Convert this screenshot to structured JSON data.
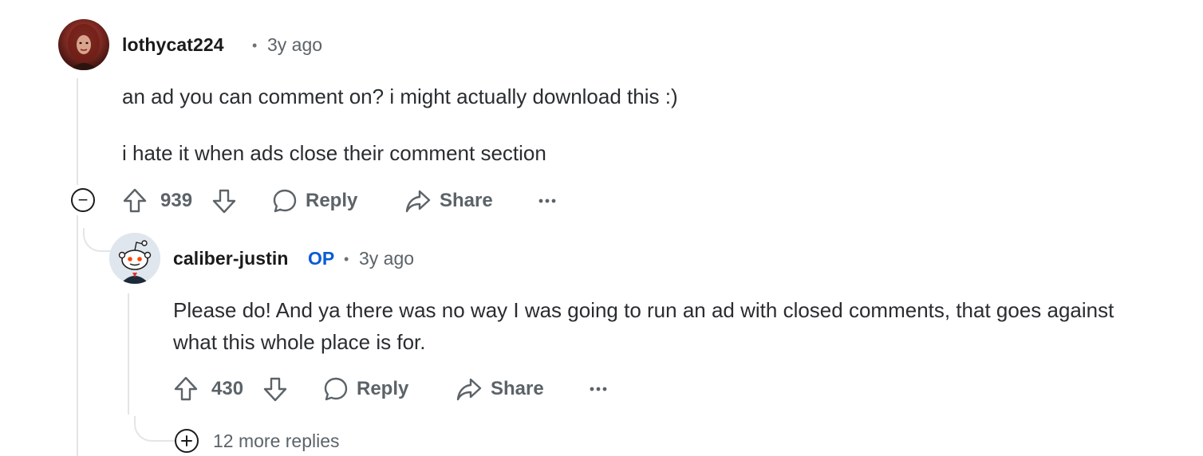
{
  "comment": {
    "username": "lothycat224",
    "separator": "•",
    "time": "3y ago",
    "paragraphs": [
      "an ad you can comment on? i might actually download this :)",
      "i hate it when ads close their comment section"
    ],
    "votes": "939",
    "reply_label": "Reply",
    "share_label": "Share",
    "collapse_symbol": "−"
  },
  "reply": {
    "username": "caliber-justin",
    "op_badge": "OP",
    "separator": "•",
    "time": "3y ago",
    "text": "Please do! And ya there was no way I was going to run an ad with closed comments, that goes against what this whole place is for.",
    "votes": "430",
    "reply_label": "Reply",
    "share_label": "Share"
  },
  "more_replies": {
    "label": "12 more replies"
  },
  "colors": {
    "op": "#0a5bd6",
    "meta": "#5c6368",
    "thread_line": "#e3e5e8"
  },
  "icons": {
    "upvote": "upvote-arrow-icon",
    "downvote": "downvote-arrow-icon",
    "reply": "speech-bubble-icon",
    "share": "share-arrow-icon",
    "more": "ellipsis-icon",
    "collapse": "minus-circle-icon",
    "expand": "plus-circle-icon"
  }
}
